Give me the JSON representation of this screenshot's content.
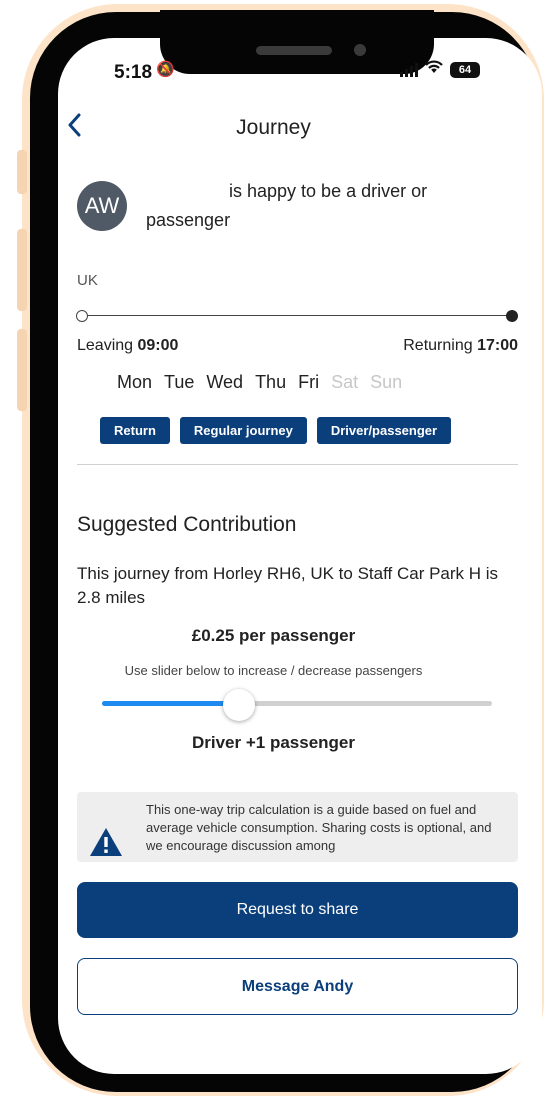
{
  "status_bar": {
    "time": "5:18",
    "battery": "64",
    "bell_icon": "bell-slash-icon",
    "wifi_icon": "wifi-icon"
  },
  "header": {
    "title": "Journey",
    "back_icon": "chevron-left-icon"
  },
  "driver": {
    "initials": "AW",
    "intro_line1": "is happy to be a driver or",
    "intro_line2": "passenger"
  },
  "route": {
    "region": "UK",
    "leaving_label": "Leaving",
    "leaving_time": "09:00",
    "returning_label": "Returning",
    "returning_time": "17:00"
  },
  "days": [
    {
      "label": "Mon",
      "active": true
    },
    {
      "label": "Tue",
      "active": true
    },
    {
      "label": "Wed",
      "active": true
    },
    {
      "label": "Thu",
      "active": true
    },
    {
      "label": "Fri",
      "active": true
    },
    {
      "label": "Sat",
      "active": false
    },
    {
      "label": "Sun",
      "active": false
    }
  ],
  "tags": [
    "Return",
    "Regular journey",
    "Driver/passenger"
  ],
  "contribution": {
    "title": "Suggested Contribution",
    "description": "This journey from Horley RH6, UK to Staff Car Park H is 2.8 miles",
    "price": "£0.25 per passenger",
    "slider_hint": "Use slider below to increase / decrease passengers",
    "slider_value_fraction": 0.35,
    "passenger_label": "Driver +1 passenger"
  },
  "notice": {
    "icon": "warning-triangle-icon",
    "text": "This one-way trip calculation is a guide based on fuel and average vehicle consumption. Sharing costs is optional, and we encourage discussion among"
  },
  "actions": {
    "request_label": "Request to share",
    "message_label": "Message Andy"
  },
  "colors": {
    "brand": "#0b3f7c",
    "slider_fill": "#1e8bf0",
    "phone_glow": "#fde3c8"
  }
}
